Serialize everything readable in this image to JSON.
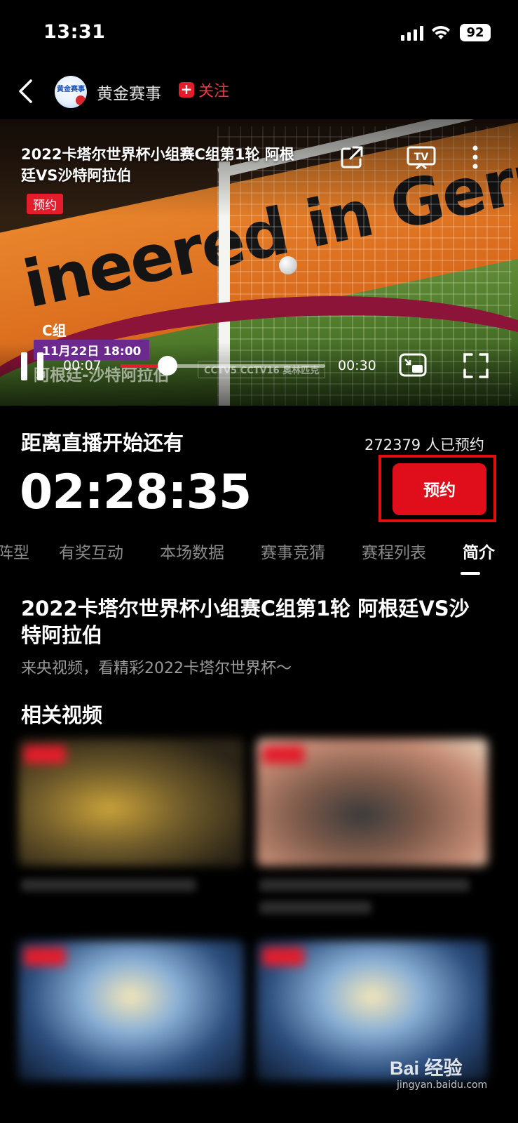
{
  "status_bar": {
    "time": "13:31",
    "battery": "92"
  },
  "header": {
    "channel_name": "黄金赛事",
    "follow_label": "关注",
    "logo_text": "黄金赛事"
  },
  "video": {
    "title": "2022卡塔尔世界杯小组赛C组第1轮 阿根廷VS沙特阿拉伯",
    "badge": "预约",
    "scene_banner_text": "ineered in Germany",
    "overlay": {
      "group": "C组",
      "date": "11月22日 18:00",
      "teams": "阿根廷-沙特阿拉伯",
      "logos": "CCTV5 CCTV16 奥林匹克"
    },
    "current_time": "00:07",
    "duration": "00:30",
    "progress": 0.23
  },
  "countdown": {
    "label": "距离直播开始还有",
    "time": "02:28:35",
    "reserve_count": "272379 人已预约",
    "reserve_button": "预约"
  },
  "tabs": [
    {
      "label": "阵型"
    },
    {
      "label": "有奖互动"
    },
    {
      "label": "本场数据"
    },
    {
      "label": "赛事竞猜"
    },
    {
      "label": "赛程列表"
    },
    {
      "label": "简介",
      "active": true
    }
  ],
  "intro": {
    "title": "2022卡塔尔世界杯小组赛C组第1轮 阿根廷VS沙特阿拉伯",
    "description": "来央视频，看精彩2022卡塔尔世界杯～"
  },
  "related": {
    "heading": "相关视频"
  },
  "watermark": {
    "brand": "Bai 经验",
    "url": "jingyan.baidu.com"
  },
  "colors": {
    "accent": "#e31d2c",
    "highlight_frame": "#e01010",
    "background": "#000000"
  }
}
